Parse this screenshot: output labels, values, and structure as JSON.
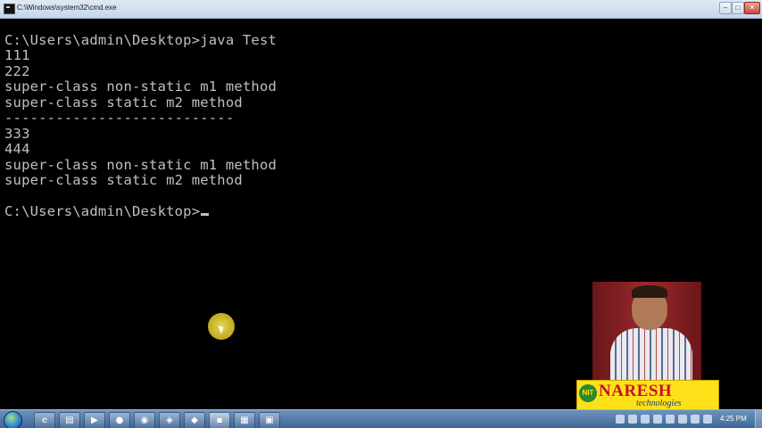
{
  "window": {
    "title": "C:\\Windows\\system32\\cmd.exe",
    "min_icon": "minimize-icon",
    "max_icon": "maximize-icon",
    "close_icon": "close-icon"
  },
  "console": {
    "lines": [
      "C:\\Users\\admin\\Desktop>java Test",
      "111",
      "222",
      "super-class non-static m1 method",
      "super-class static m2 method",
      "---------------------------",
      "333",
      "444",
      "super-class non-static m1 method",
      "super-class static m2 method",
      "",
      "C:\\Users\\admin\\Desktop>"
    ],
    "text_color": "#c0c0c0",
    "background": "#000000"
  },
  "logo": {
    "name": "NARESH",
    "subtitle": "technologies",
    "brand_color": "#c8102e",
    "background": "#ffe11a"
  },
  "taskbar": {
    "clock": "4:25 PM",
    "items": [
      "ie-icon",
      "explorer-icon",
      "media-icon",
      "firefox-icon",
      "chrome-icon",
      "network-icon",
      "cmd-icon",
      "notepad-icon",
      "app-icon"
    ]
  }
}
